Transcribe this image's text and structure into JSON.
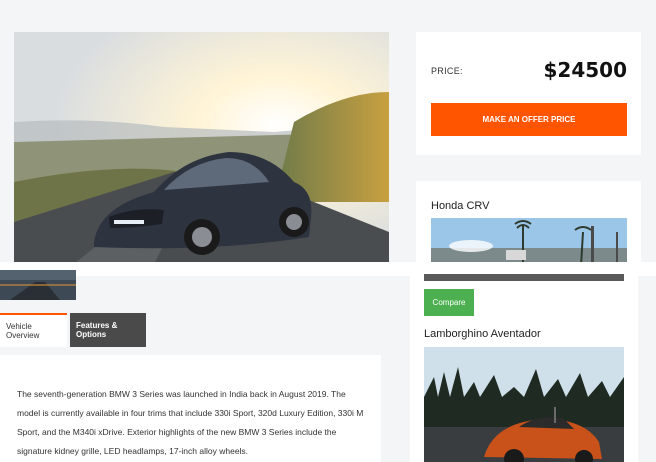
{
  "price": {
    "label": "PRICE:",
    "value": "$24500",
    "offer_button": "MAKE AN OFFER PRICE"
  },
  "tabs": [
    {
      "label": "Vehicle Overview",
      "active": true
    },
    {
      "label": "Features & Options",
      "active": false
    }
  ],
  "overview": {
    "text": "The seventh-generation BMW 3 Series was launched in India back in August 2019. The model is currently available in four trims that include 330i Sport, 320d Luxury Edition, 330i M Sport, and the M340i xDrive. Exterior highlights of the new BMW 3 Series include the signature kidney grille, LED headlamps, 17-inch alloy wheels."
  },
  "compare": {
    "cars": [
      {
        "name": "Honda CRV"
      },
      {
        "name": "Lamborghino Aventador"
      }
    ],
    "button": "Compare"
  },
  "colors": {
    "accent": "#ff5400",
    "compare": "#4caf50",
    "tab_dark": "#4a4a4a"
  },
  "icons": []
}
